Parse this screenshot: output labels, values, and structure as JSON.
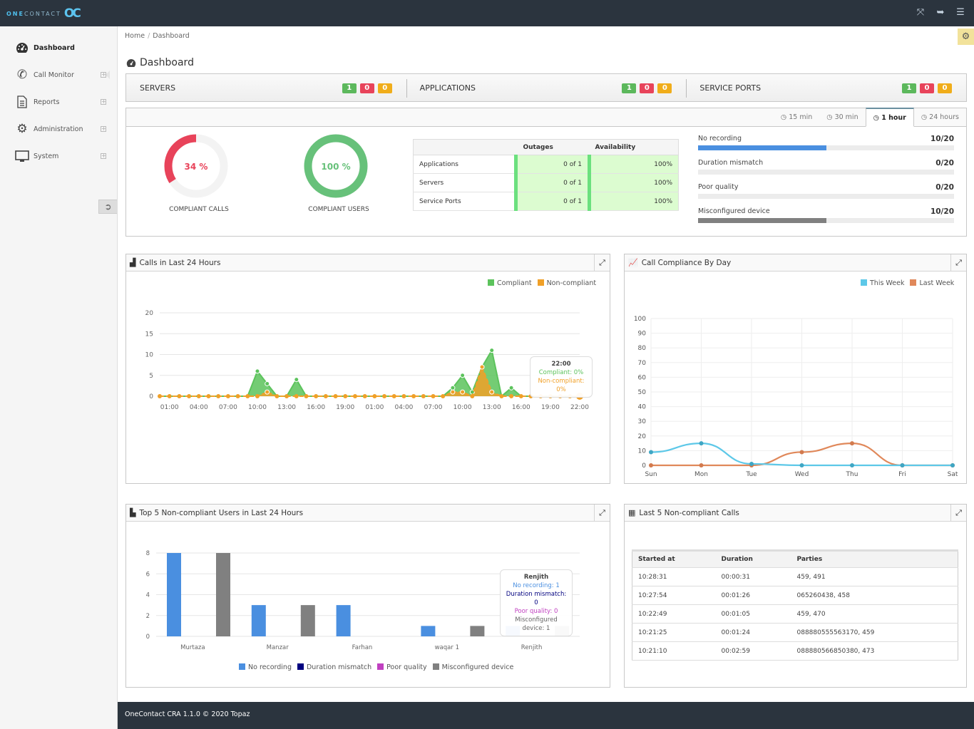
{
  "app": {
    "logo_prefix": "ONE",
    "logo_rest": "CONTACT",
    "logo_mark": "OC"
  },
  "topbar": {
    "icons": [
      "fullscreen-icon",
      "logout-icon",
      "menu-icon"
    ]
  },
  "sidebar": {
    "items": [
      {
        "label": "Dashboard",
        "icon": "dashboard-icon",
        "active": true
      },
      {
        "label": "Call Monitor",
        "icon": "phone-icon",
        "expandable": true
      },
      {
        "label": "Reports",
        "icon": "document-icon",
        "expandable": true
      },
      {
        "label": "Administration",
        "icon": "gear-icon",
        "expandable": true
      },
      {
        "label": "System",
        "icon": "monitor-icon",
        "expandable": true
      }
    ]
  },
  "breadcrumb": {
    "home": "Home",
    "current": "Dashboard"
  },
  "page_title": "Dashboard",
  "status": [
    {
      "label": "SERVERS",
      "ok": "1",
      "error": "0",
      "warn": "0"
    },
    {
      "label": "APPLICATIONS",
      "ok": "1",
      "error": "0",
      "warn": "0"
    },
    {
      "label": "SERVICE PORTS",
      "ok": "1",
      "error": "0",
      "warn": "0"
    }
  ],
  "time_tabs": [
    {
      "label": "15 min",
      "active": false
    },
    {
      "label": "30 min",
      "active": false
    },
    {
      "label": "1 hour",
      "active": true
    },
    {
      "label": "24 hours",
      "active": false
    }
  ],
  "gauges": [
    {
      "value_text": "34 %",
      "value": 34,
      "label": "COMPLIANT CALLS",
      "color": "#e8435a"
    },
    {
      "value_text": "100 %",
      "value": 100,
      "label": "COMPLIANT USERS",
      "color": "#67c17a"
    }
  ],
  "availability": {
    "headers": [
      "",
      "Outages",
      "Availability"
    ],
    "rows": [
      {
        "name": "Applications",
        "outages": "0 of 1",
        "availability": "100%"
      },
      {
        "name": "Servers",
        "outages": "0 of 1",
        "availability": "100%"
      },
      {
        "name": "Service Ports",
        "outages": "0 of 1",
        "availability": "100%"
      }
    ]
  },
  "metrics": [
    {
      "label": "No recording",
      "value": "10/20",
      "fraction": 0.5,
      "color": "#4a8fe0"
    },
    {
      "label": "Duration mismatch",
      "value": "0/20",
      "fraction": 0,
      "color": "#4a8fe0"
    },
    {
      "label": "Poor quality",
      "value": "0/20",
      "fraction": 0,
      "color": "#4a8fe0"
    },
    {
      "label": "Misconfigured device",
      "value": "10/20",
      "fraction": 0.5,
      "color": "#808080"
    }
  ],
  "panels": {
    "calls24": {
      "title": "Calls in Last 24 Hours"
    },
    "compliance_day": {
      "title": "Call Compliance By Day"
    },
    "top5": {
      "title": "Top 5 Non-compliant Users in Last 24 Hours"
    },
    "last5": {
      "title": "Last 5 Non-compliant Calls"
    }
  },
  "calls24_tooltip": {
    "title": "22:00",
    "compliant": "Compliant: 0%",
    "noncompliant": "Non-compliant: 0%"
  },
  "top5_tooltip": {
    "title": "Renjith",
    "lines": [
      "No recording: 1",
      "Duration mismatch: 0",
      "Poor quality: 0",
      "Misconfigured device: 1"
    ]
  },
  "last5_calls": {
    "headers": [
      "Started at",
      "Duration",
      "Parties"
    ],
    "rows": [
      [
        "10:28:31",
        "00:00:31",
        "459, 491"
      ],
      [
        "10:27:54",
        "00:01:26",
        "065260438, 458"
      ],
      [
        "10:22:49",
        "00:01:05",
        "459, 470"
      ],
      [
        "10:21:25",
        "00:01:24",
        "088880555563170, 459"
      ],
      [
        "10:21:10",
        "00:02:59",
        "088880566850380, 473"
      ]
    ]
  },
  "footer": "OneContact CRA 1.1.0 © 2020 Topaz",
  "chart_data": [
    {
      "type": "area",
      "title": "Calls in Last 24 Hours",
      "ylim": [
        0,
        20
      ],
      "yticks": [
        0,
        5,
        10,
        15,
        20
      ],
      "xtick_labels": [
        "01:00",
        "04:00",
        "07:00",
        "10:00",
        "13:00",
        "16:00",
        "19:00",
        "01:00",
        "04:00",
        "07:00",
        "10:00",
        "13:00",
        "16:00",
        "19:00",
        "22:00"
      ],
      "series": [
        {
          "name": "Compliant",
          "color": "#5cc35c",
          "values": [
            0,
            0,
            0,
            0,
            0,
            0,
            0,
            0,
            0,
            0,
            6,
            3,
            0,
            0,
            4,
            0,
            0,
            0,
            0,
            0,
            0,
            0,
            0,
            0,
            0,
            0,
            0,
            0,
            0,
            0,
            2,
            5,
            1,
            7,
            11,
            0,
            2,
            0,
            0,
            0,
            0,
            0,
            0,
            0
          ]
        },
        {
          "name": "Non-compliant",
          "color": "#f0a028",
          "values": [
            0,
            0,
            0,
            0,
            0,
            0,
            0,
            0,
            0,
            0,
            0,
            1,
            0,
            0,
            0,
            0,
            0,
            0,
            0,
            0,
            0,
            0,
            0,
            0,
            0,
            0,
            0,
            0,
            0,
            0,
            1,
            1,
            0,
            7,
            1,
            0,
            0,
            0,
            0,
            0,
            0,
            0,
            0,
            0
          ]
        }
      ],
      "legend": "top-right",
      "grid": true
    },
    {
      "type": "line",
      "title": "Call Compliance By Day",
      "categories": [
        "Sun",
        "Mon",
        "Tue",
        "Wed",
        "Thu",
        "Fri",
        "Sat"
      ],
      "ylim": [
        0,
        100
      ],
      "yticks": [
        0,
        10,
        20,
        30,
        40,
        50,
        60,
        70,
        80,
        90,
        100
      ],
      "series": [
        {
          "name": "This Week",
          "color": "#5dc8e8",
          "values": [
            9,
            15,
            1,
            0,
            0,
            0,
            0
          ]
        },
        {
          "name": "Last Week",
          "color": "#e0885a",
          "values": [
            0,
            0,
            0,
            9,
            15,
            0,
            0
          ]
        }
      ],
      "legend": "top-right",
      "grid": true
    },
    {
      "type": "bar",
      "title": "Top 5 Non-compliant Users in Last 24 Hours",
      "categories": [
        "Murtaza",
        "Manzar",
        "Farhan",
        "waqar 1",
        "Renjith"
      ],
      "ylim": [
        0,
        8
      ],
      "yticks": [
        0,
        2,
        4,
        6,
        8
      ],
      "series": [
        {
          "name": "No recording",
          "color": "#4a8fe0",
          "values": [
            8,
            3,
            3,
            1,
            1
          ]
        },
        {
          "name": "Duration mismatch",
          "color": "#00007f",
          "values": [
            0,
            0,
            0,
            0,
            0
          ]
        },
        {
          "name": "Poor quality",
          "color": "#c040c0",
          "values": [
            0,
            0,
            0,
            0,
            0
          ]
        },
        {
          "name": "Misconfigured device",
          "color": "#808080",
          "values": [
            8,
            3,
            0,
            1,
            1
          ]
        }
      ],
      "legend": "bottom",
      "grid": true
    }
  ]
}
